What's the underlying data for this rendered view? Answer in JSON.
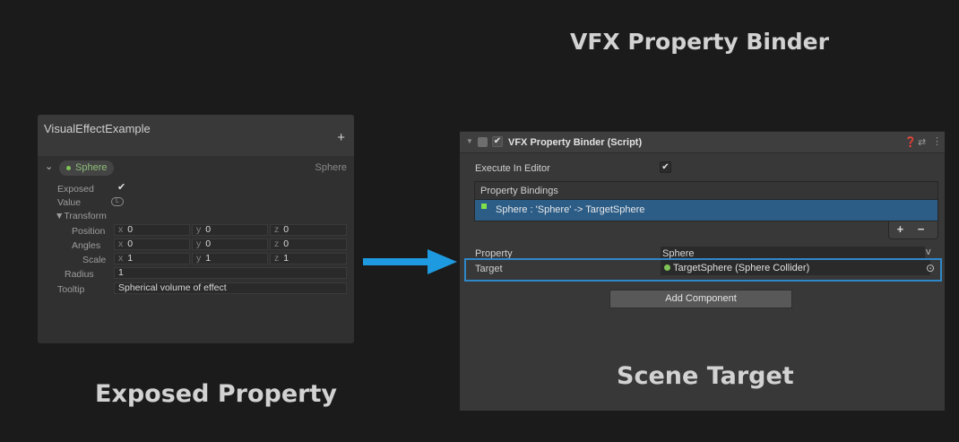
{
  "title": "VFX Property Binder",
  "captions": {
    "left": "Exposed Property",
    "right": "Scene Target"
  },
  "blackboard": {
    "title": "VisualEffectExample",
    "add_icon": "+",
    "property": {
      "chevron": "⌄",
      "name": "Sphere",
      "type": "Sphere",
      "dot_color": "#7ec457"
    },
    "exposed_label": "Exposed",
    "exposed_checked": true,
    "check_glyph": "✔",
    "value_label": "Value",
    "value_badge": "L",
    "transform_label": "▼Transform",
    "position_label": "Position",
    "angles_label": "Angles",
    "scale_label": "Scale",
    "axes": {
      "x": "x",
      "y": "y",
      "z": "z"
    },
    "position": {
      "x": "0",
      "y": "0",
      "z": "0"
    },
    "angles": {
      "x": "0",
      "y": "0",
      "z": "0"
    },
    "scale": {
      "x": "1",
      "y": "1",
      "z": "1"
    },
    "radius_label": "Radius",
    "radius": "1",
    "tooltip_label": "Tooltip",
    "tooltip": "Spherical volume of effect"
  },
  "arrow_color": "#1e9be0",
  "inspector": {
    "component_title": "VFX Property Binder (Script)",
    "component_enabled": true,
    "fold_glyph": "▼",
    "help_icon": "❓",
    "preset_icon": "⇄",
    "menu_icon": "⋮",
    "execute_in_editor_label": "Execute In Editor",
    "execute_in_editor": true,
    "property_bindings_label": "Property Bindings",
    "binding_item": "Sphere : 'Sphere' -> TargetSphere",
    "binding_color": "#7ee04a",
    "plus_minus": "+ −",
    "property_label": "Property",
    "property_value": "Sphere",
    "dropdown_glyph": "v",
    "target_label": "Target",
    "target_value": "TargetSphere (Sphere Collider)",
    "target_pick_icon": "⊙",
    "add_component": "Add Component",
    "highlight_color": "#2f87c8",
    "selected_row_color": "#2c5d87"
  }
}
